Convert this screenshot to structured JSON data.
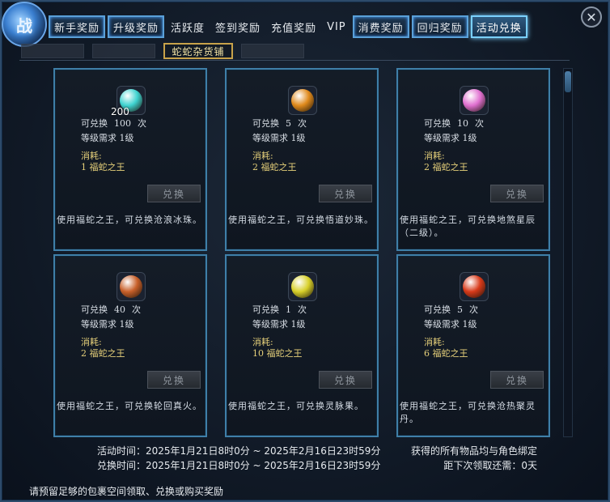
{
  "window": {
    "emblem": "战",
    "close_icon": "close-icon"
  },
  "tabs": [
    {
      "label": "新手奖励",
      "style": "boxed"
    },
    {
      "label": "升级奖励",
      "style": "boxed"
    },
    {
      "label": "活跃度",
      "style": "plain"
    },
    {
      "label": "签到奖励",
      "style": "plain"
    },
    {
      "label": "充值奖励",
      "style": "plain"
    },
    {
      "label": "VIP",
      "style": "plain"
    },
    {
      "label": "消费奖励",
      "style": "boxed"
    },
    {
      "label": "回归奖励",
      "style": "boxed"
    },
    {
      "label": "活动兑换",
      "style": "active"
    }
  ],
  "subtabs": {
    "active_label": "蛇蛇杂货铺"
  },
  "labels": {
    "can_exchange": "可兑换",
    "times": "次",
    "level_req": "等级需求",
    "cost": "消耗:",
    "exchange_button": "兑换"
  },
  "items": [
    {
      "icon": "teal-orb-icon",
      "color": "#3fd3d0",
      "qty": "200",
      "count": "100",
      "level": "1级",
      "cost": "1 福蛇之王",
      "desc": "使用福蛇之王，可兑换沧浪冰珠。"
    },
    {
      "icon": "fire-orb-icon",
      "color": "#e08a1c",
      "qty": "",
      "count": "5",
      "level": "1级",
      "cost": "2 福蛇之王",
      "desc": "使用福蛇之王，可兑换悟道妙珠。"
    },
    {
      "icon": "pink-orb-icon",
      "color": "#e070d0",
      "qty": "",
      "count": "10",
      "level": "1级",
      "cost": "2 福蛇之王",
      "desc": "使用福蛇之王，可兑换地煞星辰（二级）。"
    },
    {
      "icon": "flame-emblem-icon",
      "color": "#c8602a",
      "qty": "",
      "count": "40",
      "level": "1级",
      "cost": "2 福蛇之王",
      "desc": "使用福蛇之王，可兑换轮回真火。"
    },
    {
      "icon": "yellow-flower-icon",
      "color": "#d8d02a",
      "qty": "",
      "count": "1",
      "level": "1级",
      "cost": "10 福蛇之王",
      "desc": "使用福蛇之王，可兑换灵脉果。"
    },
    {
      "icon": "red-orb-icon",
      "color": "#d83a1a",
      "qty": "",
      "count": "5",
      "level": "1级",
      "cost": "6 福蛇之王",
      "desc": "使用福蛇之王，可兑换沧热聚灵丹。"
    }
  ],
  "footer": {
    "activity_time": "活动时间：2025年1月21日8时0分 ~ 2025年2月16日23时59分",
    "exchange_time": "兑换时间：2025年1月21日8时0分 ~ 2025年2月16日23时59分",
    "bind_note": "获得的所有物品均与角色绑定",
    "next_claim": "距下次领取还需：0天",
    "bag_note": "请预留足够的包裹空间领取、兑换或购买奖励"
  }
}
